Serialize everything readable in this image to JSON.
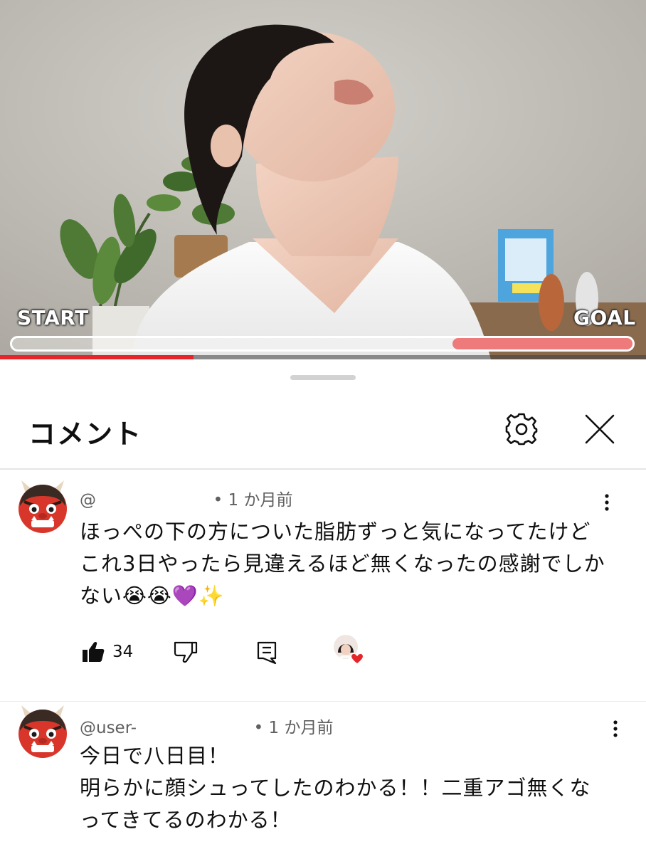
{
  "video": {
    "start_label": "START",
    "goal_label": "GOAL",
    "exercise_progress": 0.29,
    "playback_progress": 0.3
  },
  "comments_panel": {
    "title": "コメント",
    "settings_icon": "gear-icon",
    "close_icon": "close-icon"
  },
  "comments": [
    {
      "author_prefix": "@",
      "timestamp": "• 1 か月前",
      "text": "ほっぺの下の方についた脂肪ずっと気になってたけどこれ3日やったら見違えるほど無くなったの感謝でしかない😭😭💜✨",
      "likes": "34",
      "avatar_icon": "ogre-emoji-icon",
      "creator_heart": true
    },
    {
      "author_prefix": "@user-",
      "timestamp": "• 1 か月前",
      "text_lines": [
        "今日で八日目！",
        "明らかに顔シュってしたのわかる！！二重アゴ無くな",
        "ってきてるのわかる！"
      ],
      "avatar_icon": "ogre-emoji-icon"
    }
  ],
  "colors": {
    "progress_fill": "#ee7a7b",
    "seek_played": "#e5252a",
    "heart": "#e5252a",
    "meta_text": "#606060"
  }
}
